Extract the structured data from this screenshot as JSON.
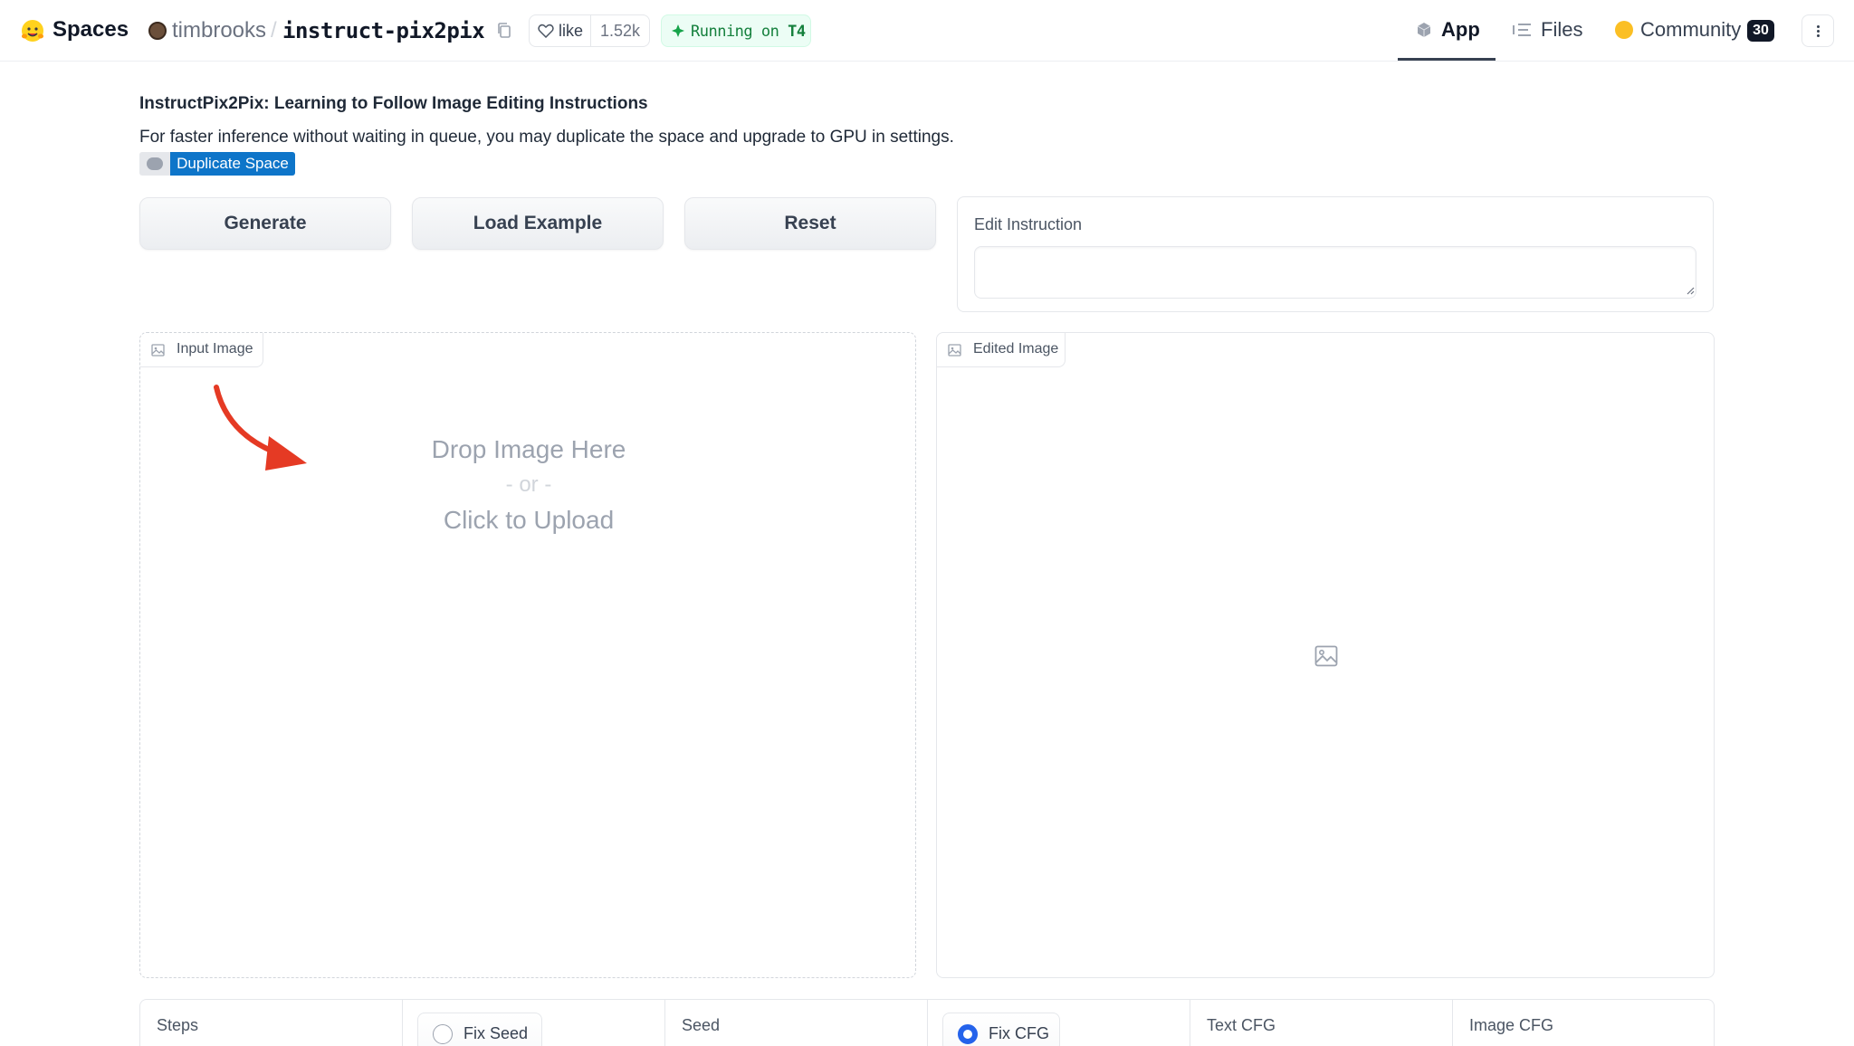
{
  "header": {
    "brand": "Spaces",
    "owner": "timbrooks",
    "separator": "/",
    "repo": "instruct-pix2pix",
    "like_label": "like",
    "like_count": "1.52k",
    "status_prefix": "Running on ",
    "status_hardware": "T4",
    "tabs": [
      {
        "label": "App",
        "icon": "cube-icon",
        "active": true
      },
      {
        "label": "Files",
        "icon": "files-icon",
        "active": false
      },
      {
        "label": "Community",
        "icon": "community-icon",
        "active": false,
        "count": "30"
      }
    ]
  },
  "intro": {
    "title": "InstructPix2Pix: Learning to Follow Image Editing Instructions",
    "description": "For faster inference without waiting in queue, you may duplicate the space and upgrade to GPU in settings.",
    "duplicate_label": "Duplicate Space"
  },
  "actions": {
    "generate": "Generate",
    "load_example": "Load Example",
    "reset": "Reset"
  },
  "instruction": {
    "label": "Edit Instruction",
    "value": ""
  },
  "input_image": {
    "label": "Input Image",
    "drop_text": "Drop Image Here",
    "or_text": "- or -",
    "click_text": "Click to Upload"
  },
  "edited_image": {
    "label": "Edited Image"
  },
  "settings": {
    "steps_label": "Steps",
    "fix_seed_label": "Fix Seed",
    "fix_seed_checked": false,
    "seed_label": "Seed",
    "fix_cfg_label": "Fix CFG",
    "fix_cfg_checked": true,
    "text_cfg_label": "Text CFG",
    "image_cfg_label": "Image CFG"
  },
  "colors": {
    "accent_blue": "#2563eb",
    "duplicate_blue": "#0e75c9",
    "running_green": "#15803d",
    "annotation_arrow": "#e53a24"
  }
}
